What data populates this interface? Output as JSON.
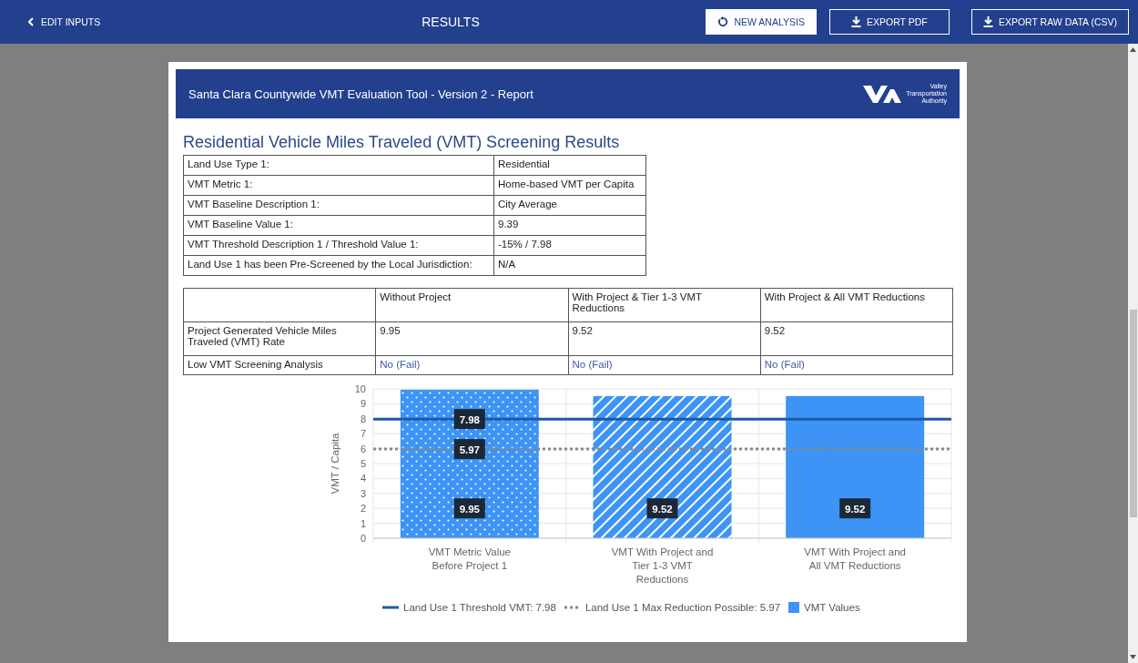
{
  "top_bar": {
    "back_link": "EDIT INPUTS",
    "title": "RESULTS",
    "buttons": [
      {
        "label": "NEW ANALYSIS",
        "kind": "filled"
      },
      {
        "label": "EXPORT PDF",
        "kind": "outline"
      },
      {
        "label": "EXPORT RAW DATA (CSV)",
        "kind": "outline"
      }
    ]
  },
  "report": {
    "header_title": "Santa Clara Countywide VMT Evaluation Tool - Version 2 - Report",
    "logo_text": "Valley Transportation Authority",
    "heading": "Residential Vehicle Miles Traveled (VMT) Screening Results",
    "summary_rows": [
      {
        "label": "Land Use Type 1:",
        "value": "Residential"
      },
      {
        "label": "VMT Metric 1:",
        "value": "Home-based VMT per Capita"
      },
      {
        "label": "VMT Baseline Description 1:",
        "value": "City Average"
      },
      {
        "label": "VMT Baseline Value 1:",
        "value": "9.39"
      },
      {
        "label": "VMT Threshold Description 1 / Threshold Value 1:",
        "value": "-15% / 7.98"
      },
      {
        "label": "Land Use 1 has been Pre-Screened by the Local Jurisdiction:",
        "value": "N/A"
      }
    ],
    "results_table": {
      "columns": [
        "Without Project",
        "With Project & Tier 1-3 VMT Reductions",
        "With Project & All VMT Reductions"
      ],
      "rows": [
        {
          "label": "Project Generated Vehicle Miles Traveled (VMT) Rate",
          "kind": "value",
          "cells": [
            "9.95",
            "9.52",
            "9.52"
          ]
        },
        {
          "label": "Low VMT Screening Analysis",
          "kind": "result",
          "cells": [
            "No (Fail)",
            "No (Fail)",
            "No (Fail)"
          ]
        }
      ]
    },
    "chart_data": {
      "type": "bar",
      "ylabel": "VMT / Capita",
      "categories": [
        "VMT Metric Value Before Project 1",
        "VMT With Project and Tier 1-3 VMT Reductions",
        "VMT With Project and All VMT Reductions"
      ],
      "series": [
        {
          "name": "VMT Values",
          "type": "bar",
          "color": "#3d94f6",
          "values": [
            9.95,
            9.52,
            9.52
          ],
          "value_labels": [
            "9.95",
            "9.52",
            "9.52"
          ]
        }
      ],
      "ref_lines": [
        {
          "axis": "y",
          "value": 7.98,
          "label": "Land Use 1 Threshold VMT: 7.98",
          "color": "#1c5aa6",
          "line_style": "solid"
        },
        {
          "axis": "y",
          "value": 5.97,
          "label": "Land Use 1 Max Reduction Possible: 5.97",
          "color": "#888888",
          "line_style": "dotted"
        }
      ],
      "annotations": [
        {
          "text": "7.98",
          "x": "VMT Metric Value Before Project 1",
          "y": 7.98
        },
        {
          "text": "5.97",
          "x": "VMT Metric Value Before Project 1",
          "y": 5.97
        }
      ],
      "ylim": [
        0,
        10
      ],
      "yticks": [
        0,
        1,
        2,
        3,
        4,
        5,
        6,
        7,
        8,
        9,
        10
      ],
      "grid": true,
      "legend": "bottom"
    }
  }
}
